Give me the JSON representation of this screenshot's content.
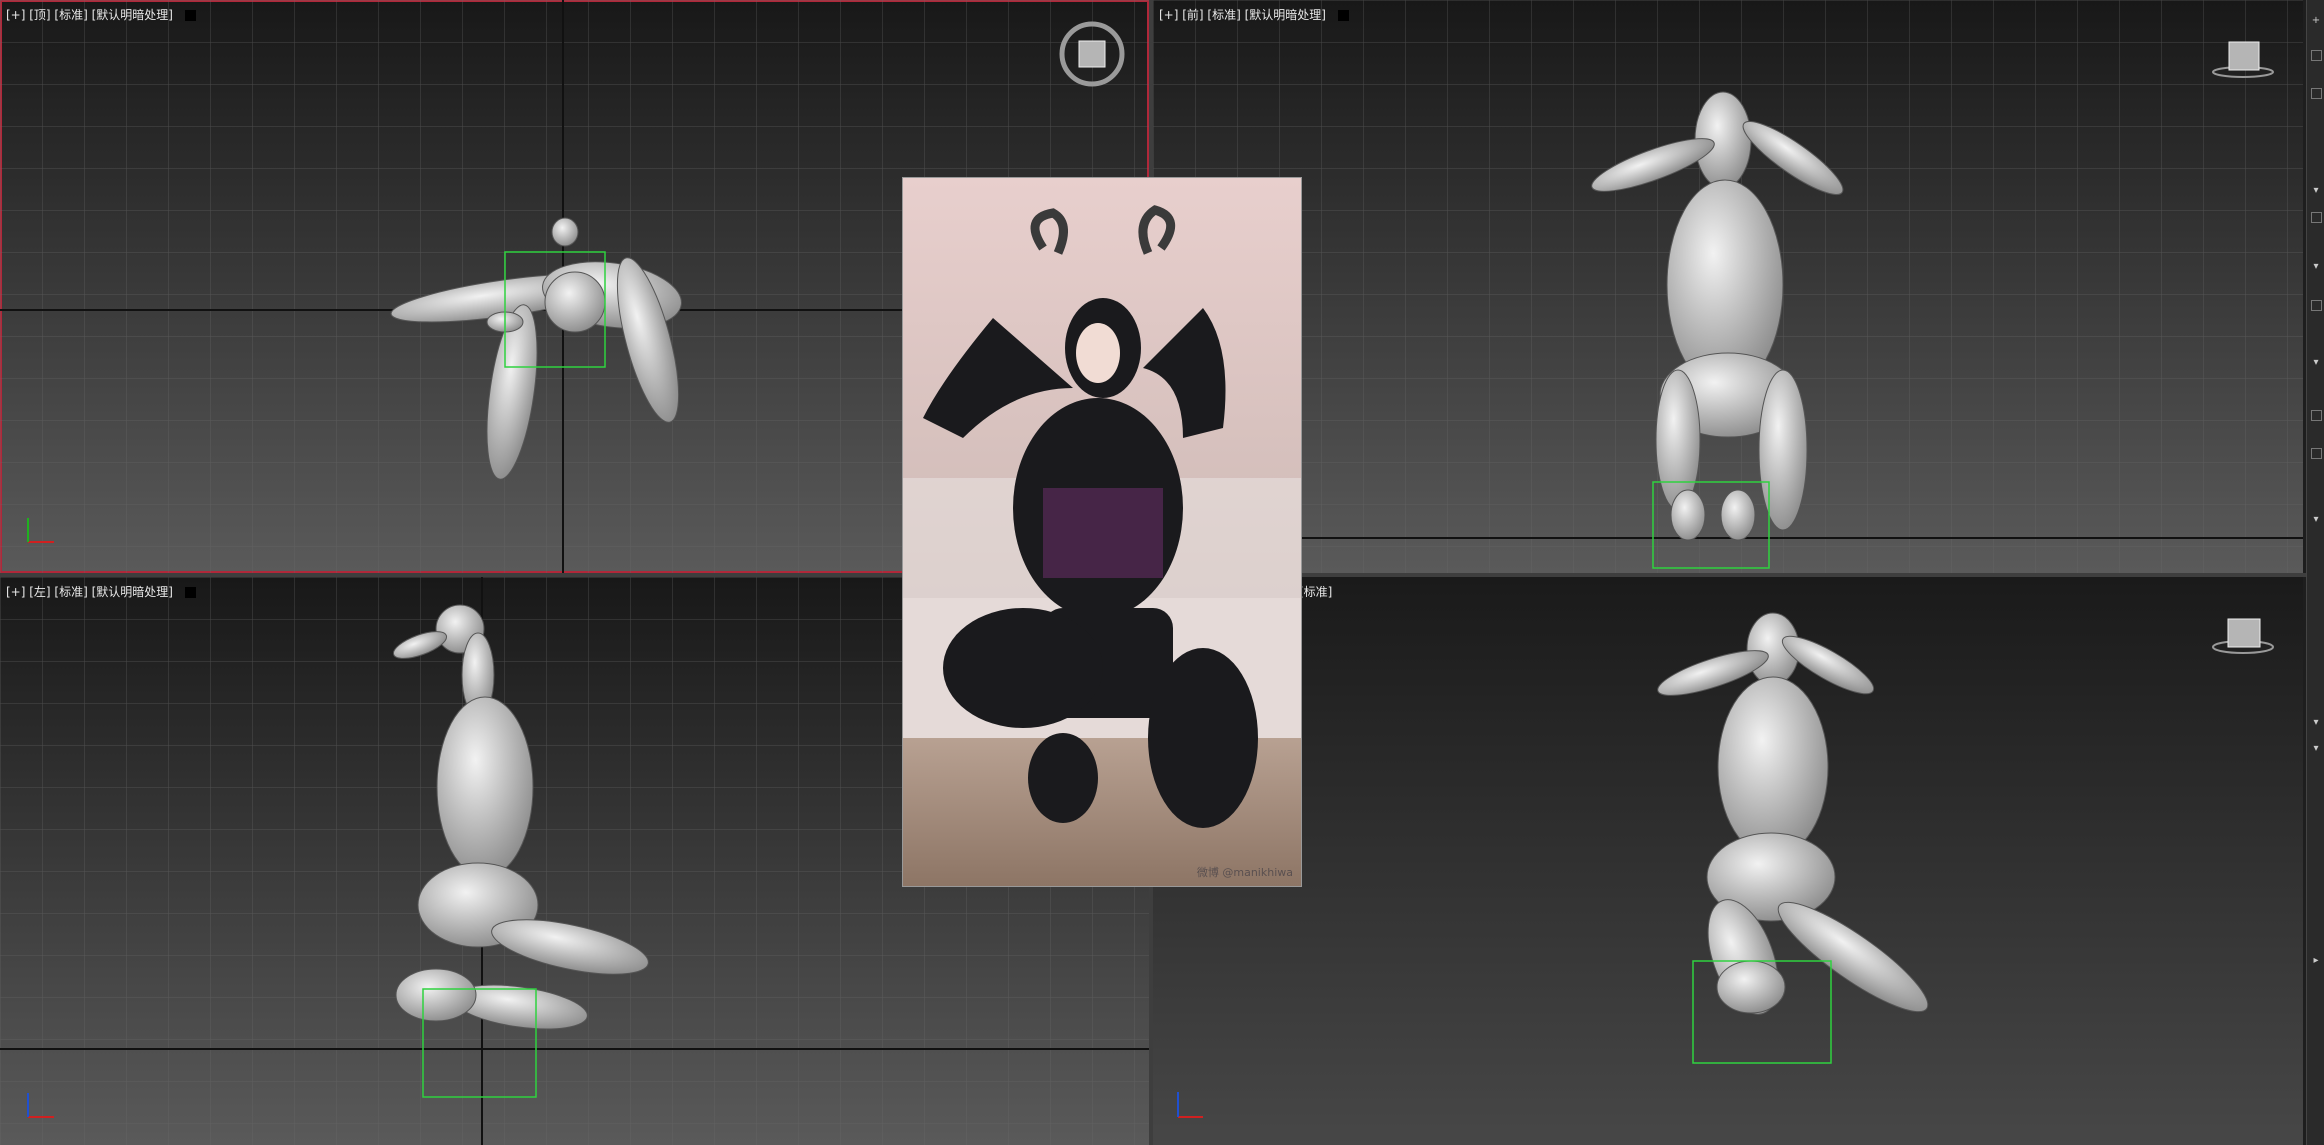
{
  "viewports": {
    "top": {
      "label_text": "[+] [顶] [标准] [默认明暗处理]"
    },
    "front": {
      "label_text": "[+] [前] [标准] [默认明暗处理]"
    },
    "left": {
      "label_text": "[+] [左] [标准] [默认明暗处理]"
    },
    "perspective": {
      "label_text": "[标准]"
    }
  },
  "right_toolbar": {
    "glyphs": [
      "+",
      "▾",
      "▾",
      "▾",
      "▾",
      "▾",
      "▾",
      "▸"
    ]
  },
  "reference_photo": {
    "watermark_text": "微博 @manikhiwa"
  },
  "colors": {
    "active_viewport_border": "#b0283a",
    "grid_line": "#6c6c6c",
    "selection_box": "#2fd23f",
    "mannequin": "#c8c8c8"
  }
}
